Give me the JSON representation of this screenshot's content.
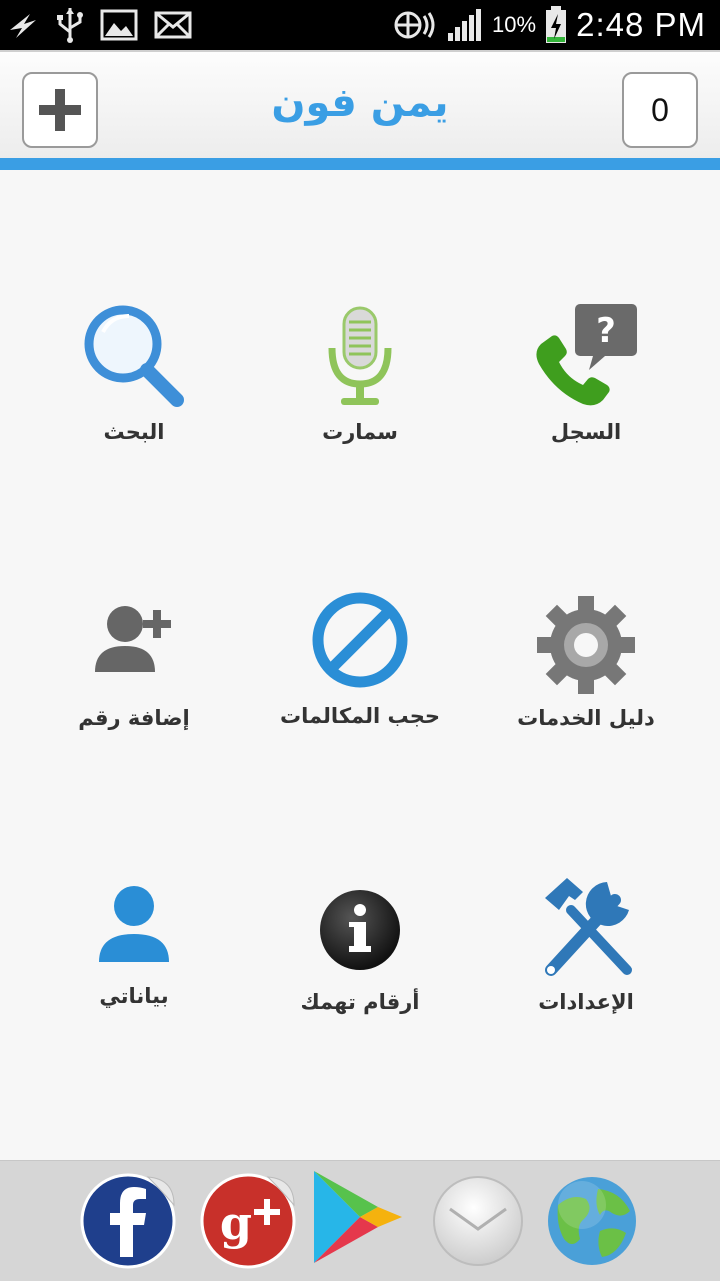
{
  "status_bar": {
    "battery": "10%",
    "time": "2:48 PM"
  },
  "header": {
    "title": "يمن فون",
    "counter": "0"
  },
  "menu": [
    {
      "label": "السجل",
      "icon": "phone-question-icon"
    },
    {
      "label": "سمارت",
      "icon": "microphone-icon"
    },
    {
      "label": "البحث",
      "icon": "magnifier-icon"
    },
    {
      "label": "دليل الخدمات",
      "icon": "gear-icon"
    },
    {
      "label": "حجب المكالمات",
      "icon": "block-icon"
    },
    {
      "label": "إضافة رقم",
      "icon": "add-user-icon"
    },
    {
      "label": "الإعدادات",
      "icon": "tools-icon"
    },
    {
      "label": "أرقام تهمك",
      "icon": "info-icon"
    },
    {
      "label": "بياناتي",
      "icon": "user-icon"
    }
  ],
  "dock": [
    "facebook-icon",
    "google-plus-icon",
    "play-store-icon",
    "mail-icon",
    "globe-icon"
  ],
  "colors": {
    "accent": "#3a9ee4",
    "header_bg": "#f2f2f2",
    "dock_bg": "#d6d6d6"
  }
}
